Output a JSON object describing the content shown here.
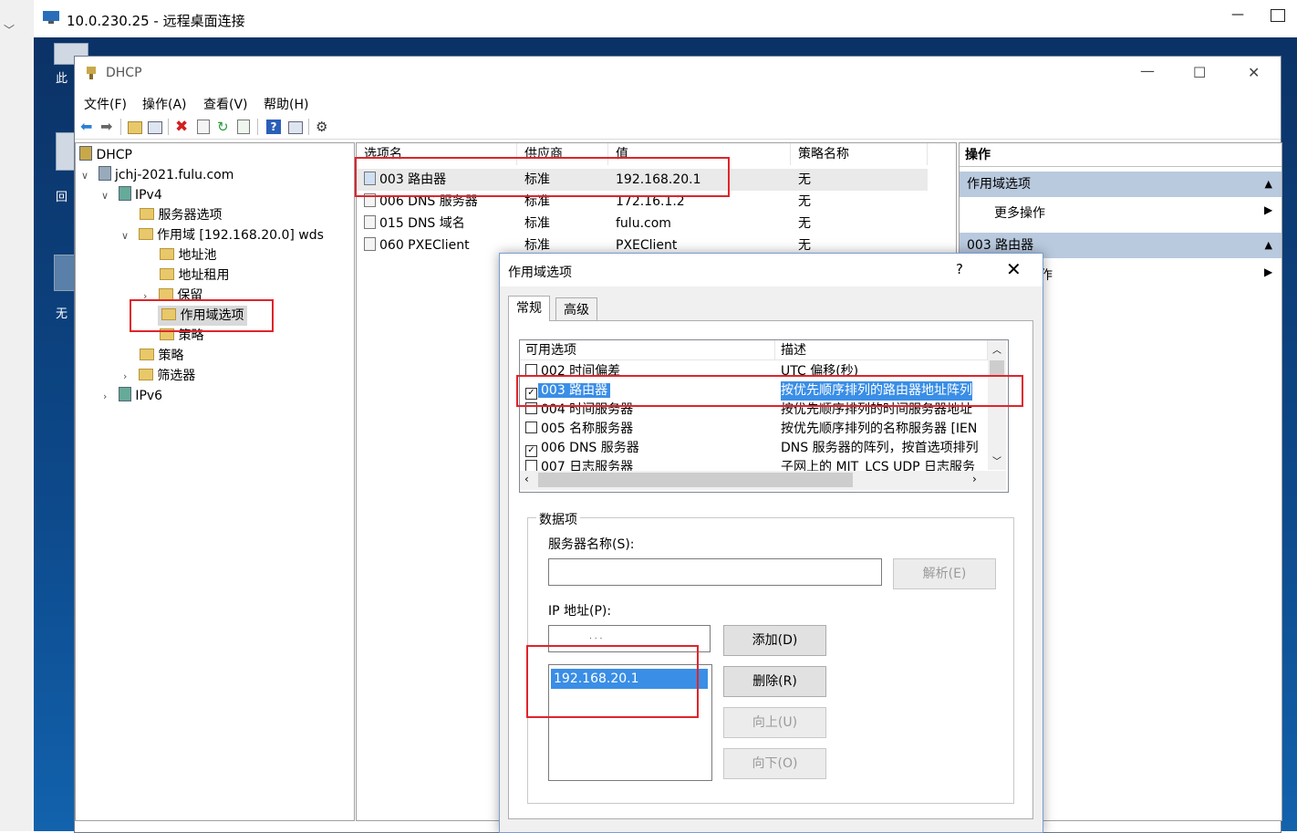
{
  "rdp": {
    "title": "10.0.230.25 - 远程桌面连接",
    "minimize": "—"
  },
  "desktop": {
    "icons": [
      "此",
      "回",
      "无"
    ]
  },
  "mmc": {
    "title": "DHCP",
    "menu": [
      "文件(F)",
      "操作(A)",
      "查看(V)",
      "帮助(H)"
    ],
    "window_controls": {
      "minimize": "—",
      "maximize": "☐",
      "close": "✕"
    }
  },
  "tree": {
    "items": [
      {
        "label": "DHCP"
      },
      {
        "label": "jchj-2021.fulu.com"
      },
      {
        "label": "IPv4"
      },
      {
        "label": "服务器选项"
      },
      {
        "label": "作用域 [192.168.20.0] wds"
      },
      {
        "label": "地址池"
      },
      {
        "label": "地址租用"
      },
      {
        "label": "保留"
      },
      {
        "label": "作用域选项"
      },
      {
        "label": "策略"
      },
      {
        "label": "策略"
      },
      {
        "label": "筛选器"
      },
      {
        "label": "IPv6"
      }
    ]
  },
  "list": {
    "columns": [
      "选项名",
      "供应商",
      "值",
      "策略名称"
    ],
    "rows": [
      {
        "name": "003 路由器",
        "vendor": "标准",
        "value": "192.168.20.1",
        "policy": "无"
      },
      {
        "name": "006 DNS 服务器",
        "vendor": "标准",
        "value": "172.16.1.2",
        "policy": "无"
      },
      {
        "name": "015 DNS 域名",
        "vendor": "标准",
        "value": "fulu.com",
        "policy": "无"
      },
      {
        "name": "060 PXEClient",
        "vendor": "标准",
        "value": "PXEClient",
        "policy": "无"
      }
    ]
  },
  "actions": {
    "header": "操作",
    "section1": "作用域选项",
    "more": "更多操作",
    "section2": "003 路由器",
    "partial": "作"
  },
  "dialog": {
    "title": "作用域选项",
    "help": "?",
    "close": "✕",
    "tabs": [
      "常规",
      "高级"
    ],
    "options_columns": [
      "可用选项",
      "描述"
    ],
    "options": [
      {
        "checked": false,
        "label": "002 时间偏差",
        "desc": "UTC 偏移(秒)"
      },
      {
        "checked": true,
        "label": "003 路由器",
        "desc": "按优先顺序排列的路由器地址阵列"
      },
      {
        "checked": false,
        "label": "004 时间服务器",
        "desc": "按优先顺序排列的时间服务器地址"
      },
      {
        "checked": false,
        "label": "005 名称服务器",
        "desc": "按优先顺序排列的名称服务器 [IEN"
      },
      {
        "checked": true,
        "label": "006 DNS 服务器",
        "desc": "DNS 服务器的阵列，按首选项排列"
      },
      {
        "checked": false,
        "label": "007 日志服务器",
        "desc": "子网上的 MIT_LCS UDP 日志服务"
      }
    ],
    "data_group": "数据项",
    "server_name_label": "服务器名称(S):",
    "server_name_value": "",
    "resolve_button": "解析(E)",
    "ip_label": "IP 地址(P):",
    "ip_input": ".   .   .",
    "ip_list": [
      "192.168.20.1"
    ],
    "add_button": "添加(D)",
    "remove_button": "删除(R)",
    "up_button": "向上(U)",
    "down_button": "向下(O)"
  }
}
